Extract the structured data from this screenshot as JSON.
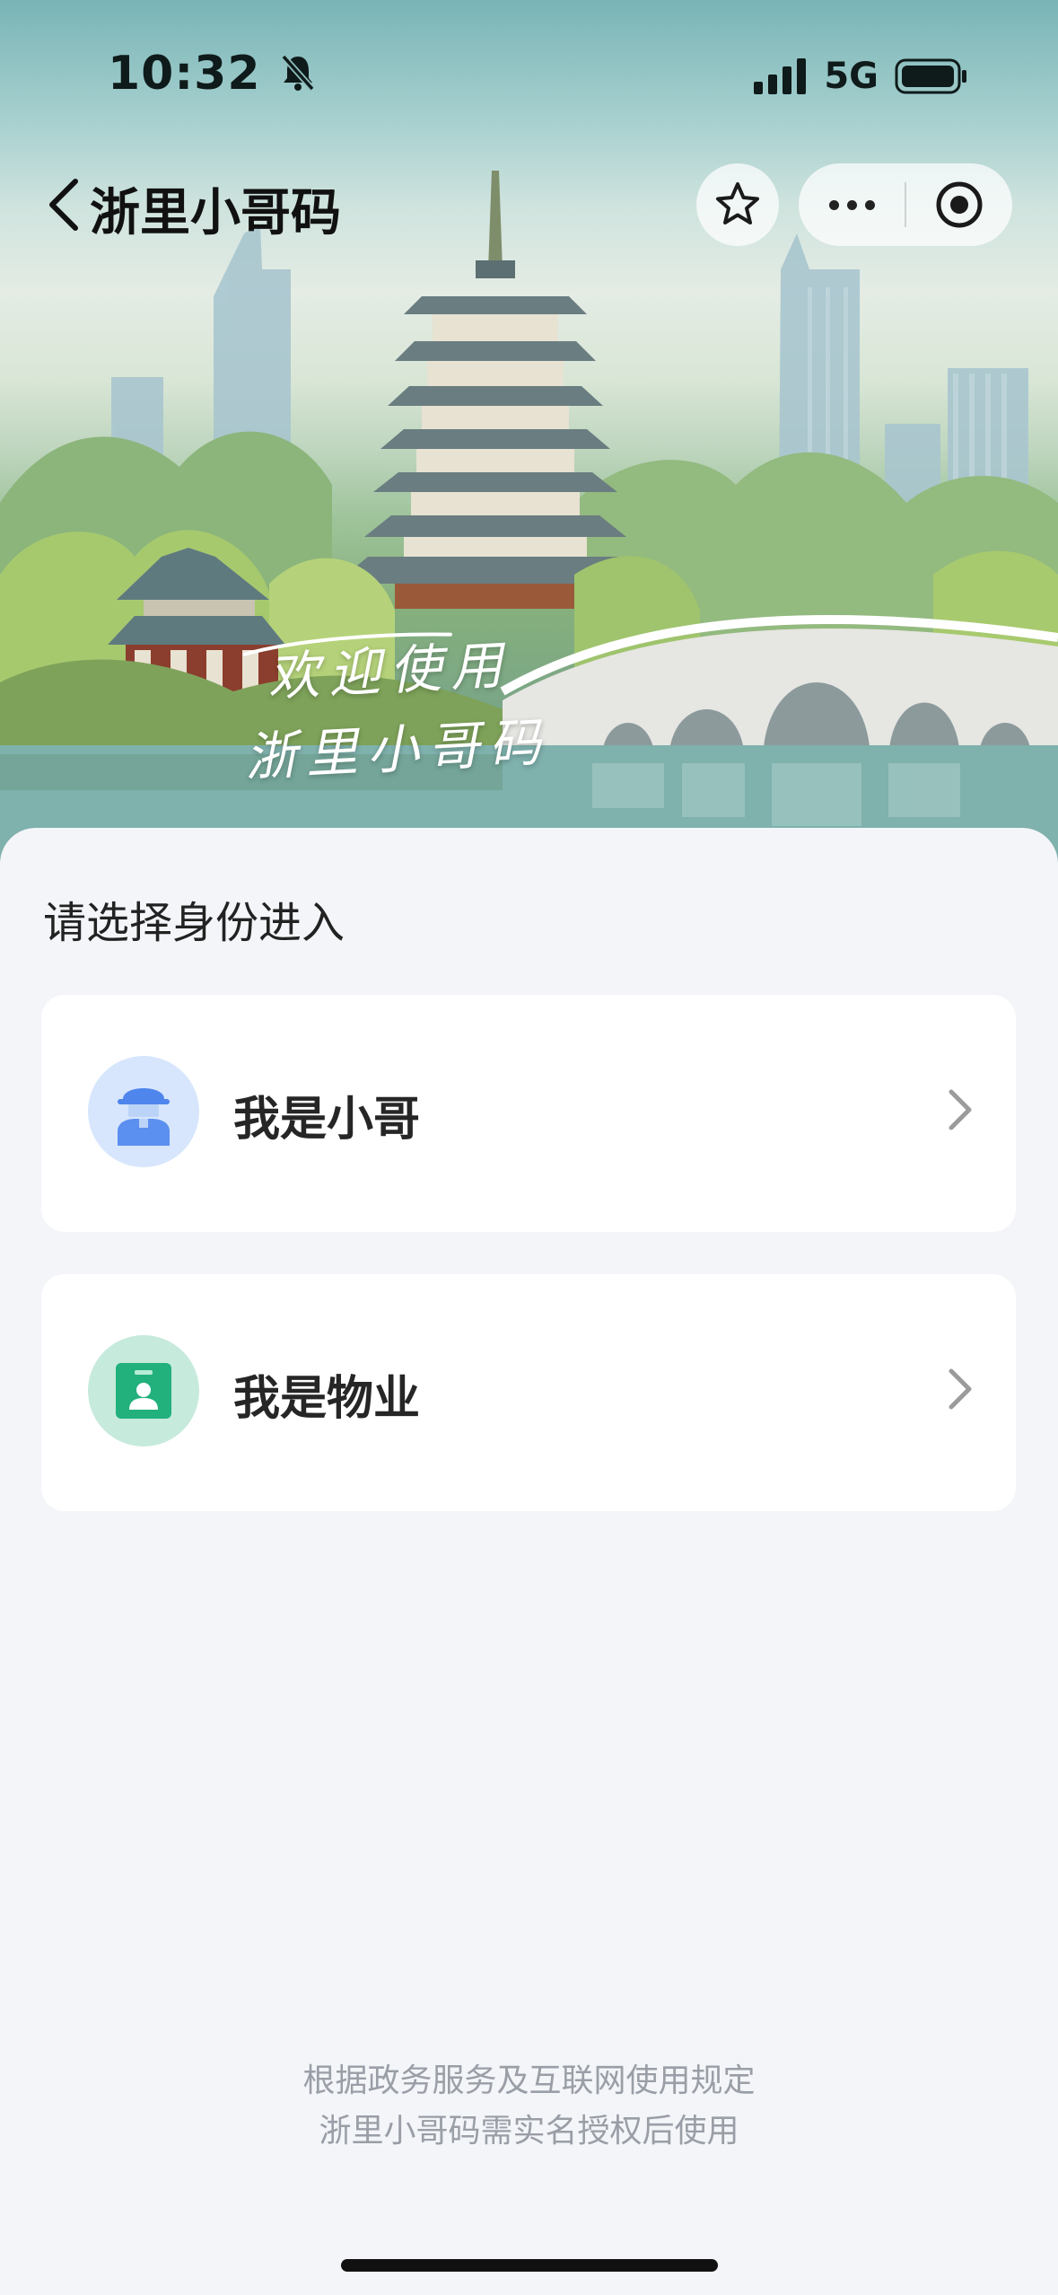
{
  "status_bar": {
    "time": "10:32",
    "network": "5G",
    "icons": [
      "bell-muted-icon",
      "signal-icon",
      "battery-icon"
    ]
  },
  "nav": {
    "title": "浙里小哥码",
    "icons": [
      "back-chevron-icon",
      "star-icon",
      "more-icon",
      "close-circle-icon"
    ]
  },
  "hero": {
    "welcome_line1": "欢迎使用",
    "welcome_line2": "浙里小哥码"
  },
  "main": {
    "section_title": "请选择身份进入",
    "roles": [
      {
        "label": "我是小哥",
        "icon": "courier-avatar-icon",
        "accent": "#5b8ff0"
      },
      {
        "label": "我是物业",
        "icon": "property-badge-icon",
        "accent": "#22b07d"
      }
    ]
  },
  "footer": {
    "line1": "根据政务服务及互联网使用规定",
    "line2": "浙里小哥码需实名授权后使用"
  }
}
